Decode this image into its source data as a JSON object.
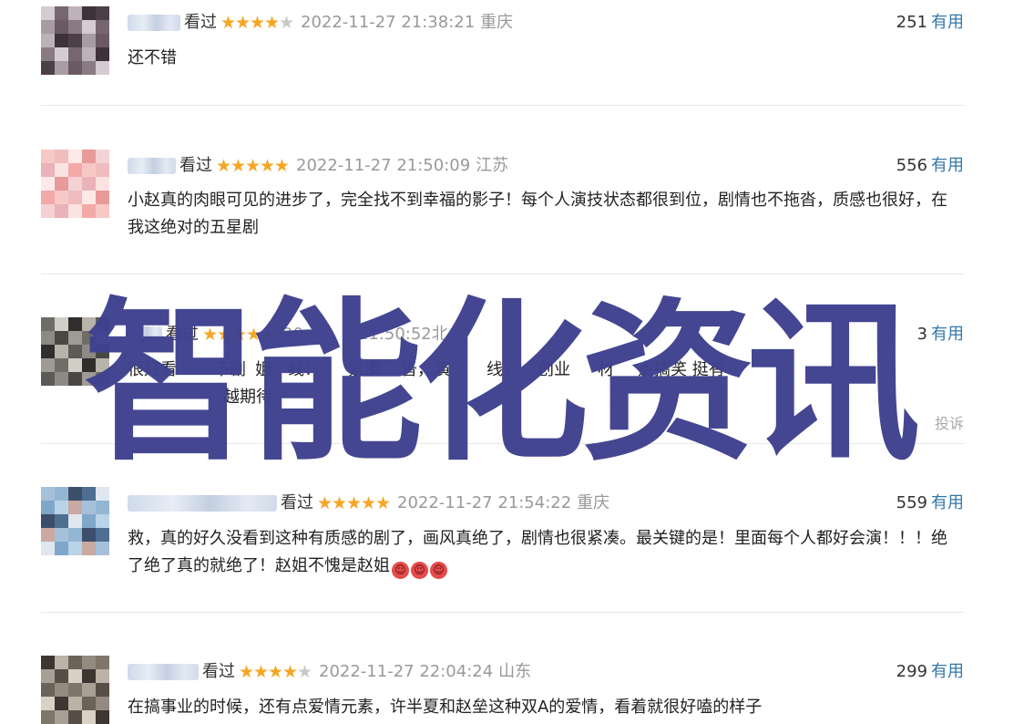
{
  "comments": [
    {
      "watched": "看过",
      "rating": 4,
      "time": "2022-11-27 21:38:21",
      "location": "重庆",
      "votes": "251",
      "useful": "有用",
      "text": "还不错"
    },
    {
      "watched": "看过",
      "rating": 5,
      "time": "2022-11-27 21:50:09",
      "location": "江苏",
      "votes": "556",
      "useful": "有用",
      "text": "小赵真的肉眼可见的进步了，完全找不到幸福的影子！每个人演技状态都很到位，剧情也不拖沓，质感也很好，在我这绝对的五星剧"
    },
    {
      "watched": "看过",
      "rating": 5,
      "time_fragment_1": "20",
      "time_fragment_2": "21:50:52",
      "location": "北",
      "votes": "3",
      "useful": "有用",
      "text_line1_fragments": [
        "很好看",
        "不剧",
        "姐",
        "线！",
        "紧凑",
        "沓，演",
        "线，",
        "创业",
        "材",
        "点搞笑 挺有"
      ],
      "text_line2_fragment": "越期待",
      "report": "投诉"
    },
    {
      "watched": "看过",
      "rating": 5,
      "time": "2022-11-27 21:54:22",
      "location": "重庆",
      "votes": "559",
      "useful": "有用",
      "text": "救，真的好久没看到这种有质感的剧了，画风真绝了，剧情也很紧凑。最关键的是！里面每个人都好会演！！！绝了绝了真的就绝了！赵姐不愧是赵姐",
      "emoji_count": 3,
      "emoji_icon": "angry-face-emoji"
    },
    {
      "watched": "看过",
      "rating": 4,
      "time": "2022-11-27 22:04:24",
      "location": "山东",
      "votes": "299",
      "useful": "有用",
      "text": "在搞事业的时候，还有点爱情元素，许半夏和赵垒这种双A的爱情，看着就很好嗑的样子"
    }
  ],
  "watermark": "智能化资讯",
  "colors": {
    "star_on": "#f5a623",
    "star_off": "#c8c8c8",
    "useful_link": "#3377aa",
    "meta_gray": "#999999",
    "watermark": "#3f418f"
  }
}
